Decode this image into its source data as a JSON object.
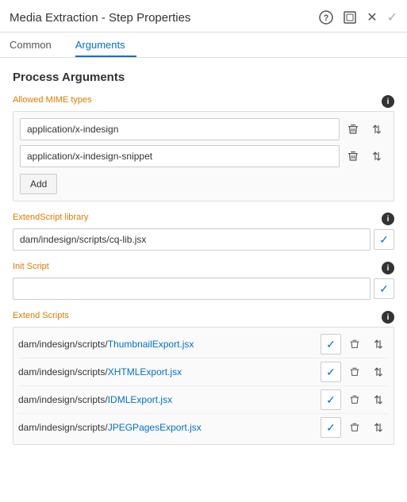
{
  "header": {
    "title": "Media Extraction - Step Properties",
    "help_icon": "?",
    "expand_icon": "⊡",
    "close_icon": "✕",
    "check_icon": "✓"
  },
  "tabs": [
    {
      "id": "common",
      "label": "Common",
      "active": false
    },
    {
      "id": "arguments",
      "label": "Arguments",
      "active": true
    }
  ],
  "process_arguments": {
    "title": "Process Arguments",
    "allowed_mime_types": {
      "label": "Allowed MIME types",
      "items": [
        {
          "value": "application/x-indesign"
        },
        {
          "value": "application/x-indesign-snippet"
        }
      ],
      "add_label": "Add"
    },
    "extendscript_library": {
      "label": "ExtendScript library",
      "value": "dam/indesign/scripts/cq-lib.jsx",
      "checked": true
    },
    "init_script": {
      "label": "Init Script",
      "value": "",
      "checked": true
    },
    "extend_scripts": {
      "label": "Extend Scripts",
      "items": [
        {
          "prefix": "dam/indesign/scripts/",
          "link": "ThumbnailExport.jsx",
          "checked": true
        },
        {
          "prefix": "dam/indesign/scripts/",
          "link": "XHTMLExport.jsx",
          "checked": true
        },
        {
          "prefix": "dam/indesign/scripts/",
          "link": "IDMLExport.jsx",
          "checked": true
        },
        {
          "prefix": "dam/indesign/scripts/",
          "link": "JPEGPagesExport.jsx",
          "checked": true
        }
      ]
    }
  }
}
